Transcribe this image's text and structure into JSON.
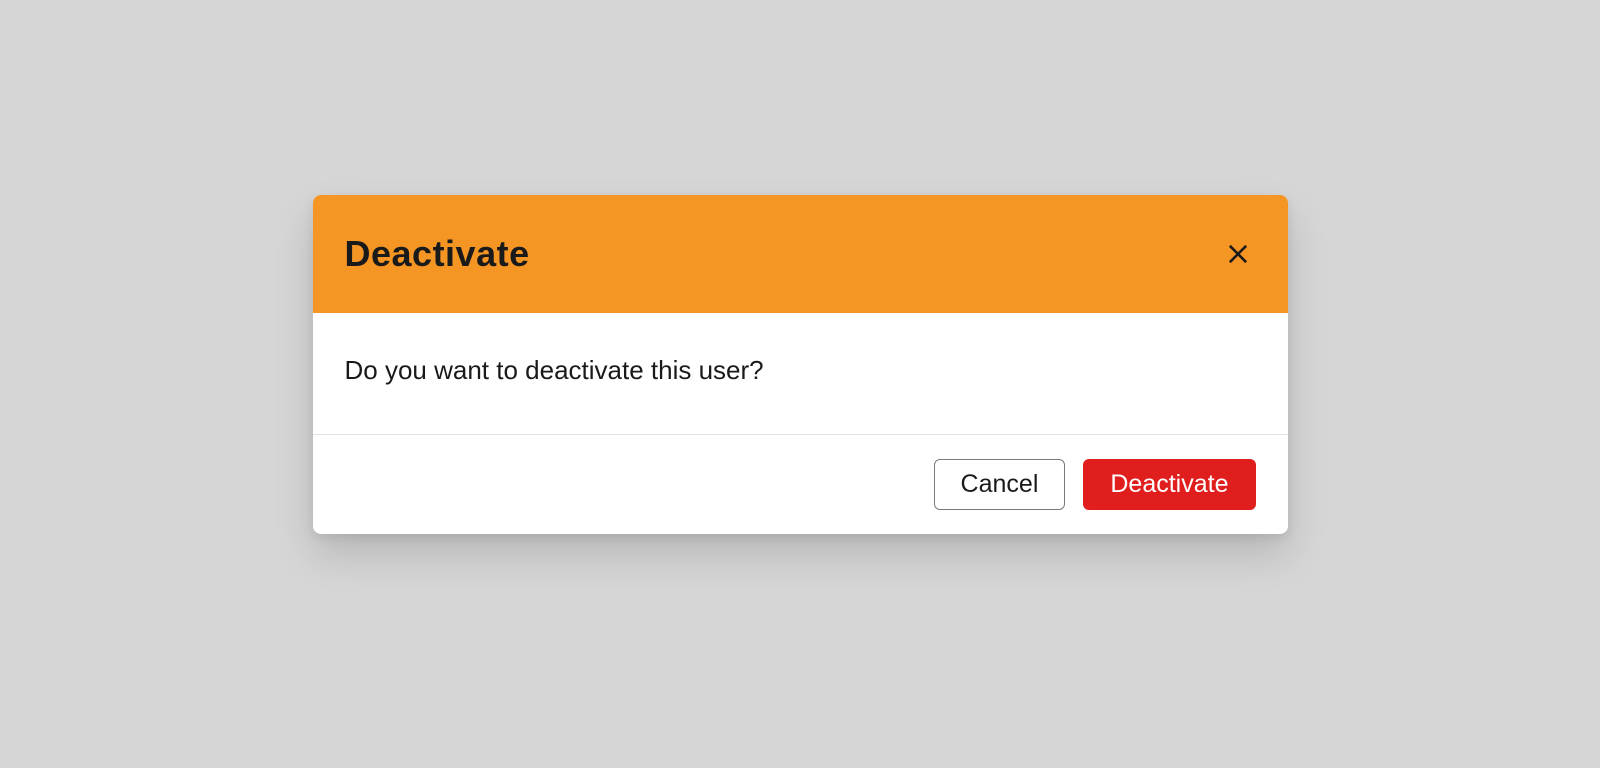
{
  "dialog": {
    "title": "Deactivate",
    "message": "Do you want to deactivate this user?",
    "cancel_label": "Cancel",
    "confirm_label": "Deactivate"
  }
}
